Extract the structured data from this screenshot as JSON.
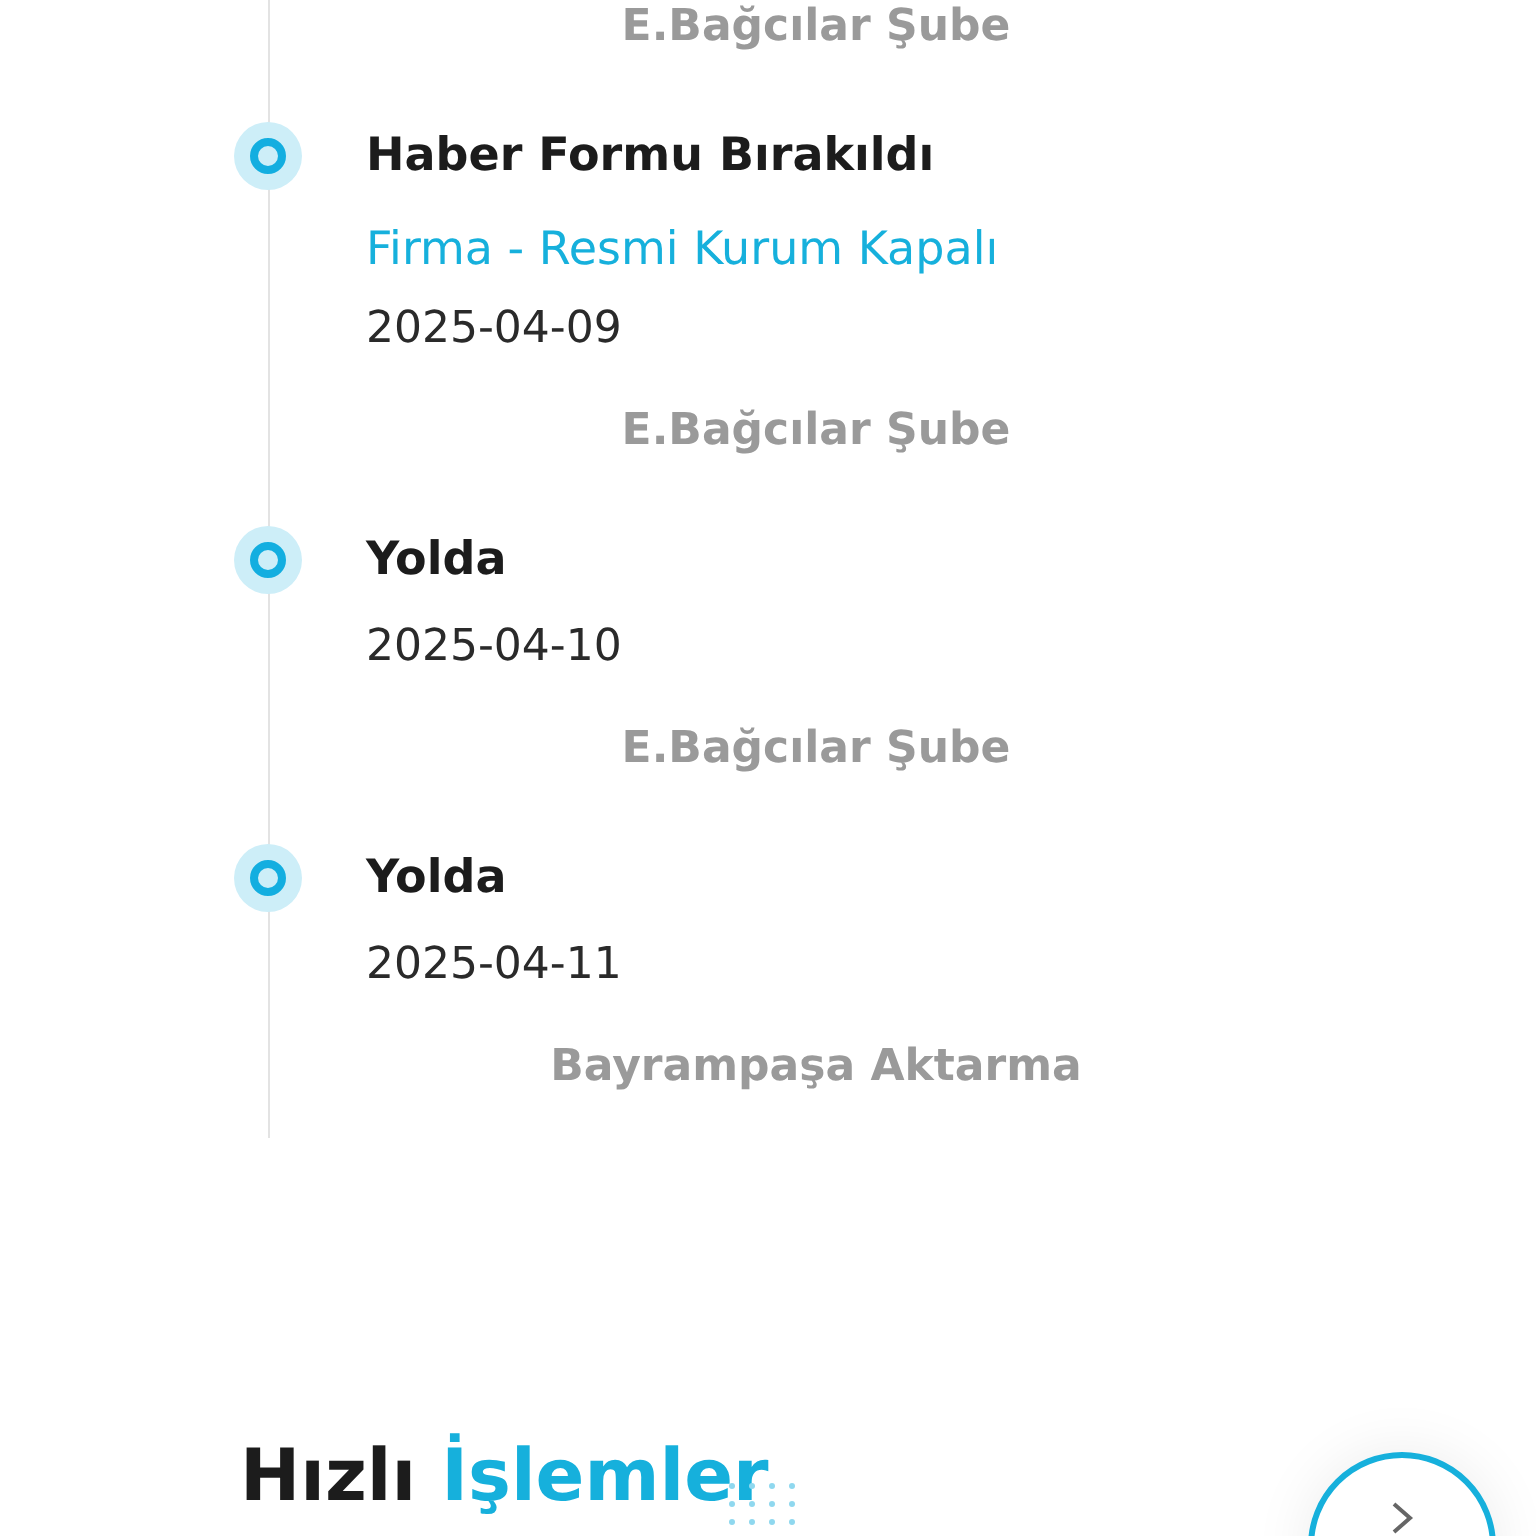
{
  "top_branch": "E.Bağcılar Şube",
  "events": [
    {
      "title": "Haber Formu Bırakıldı",
      "note": "Firma - Resmi Kurum Kapalı",
      "date": "2025-04-09",
      "branch": "E.Bağcılar Şube"
    },
    {
      "title": "Yolda",
      "date": "2025-04-10",
      "branch": "E.Bağcılar Şube"
    },
    {
      "title": "Yolda",
      "date": "2025-04-11",
      "branch": "Bayrampaşa Aktarma"
    }
  ],
  "quick_actions": {
    "title": "Hızlı",
    "title_accent": "İşlemler"
  }
}
